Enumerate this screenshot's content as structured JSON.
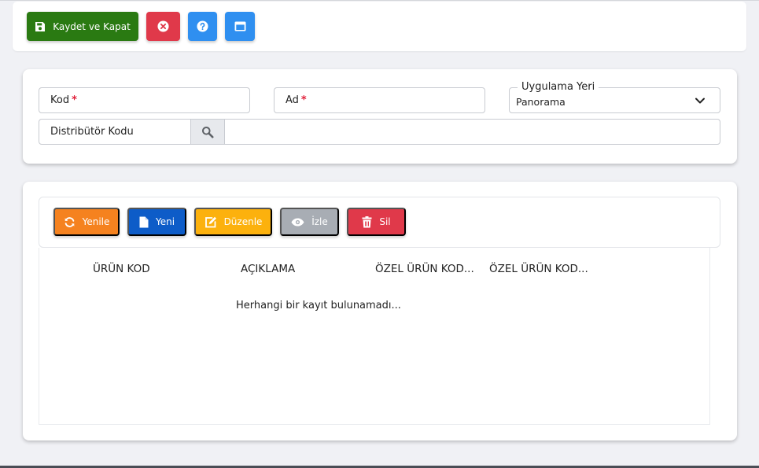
{
  "toolbar": {
    "save_label": "Kaydet ve Kapat",
    "colors": {
      "save": "#2a7a12",
      "close": "#e0394a",
      "help": "#2f8ff0",
      "window": "#2f8ff0"
    },
    "icons": [
      "save-icon",
      "close-circle-icon",
      "help-circle-icon",
      "window-icon"
    ]
  },
  "form": {
    "kod_label": "Kod",
    "ad_label": "Ad",
    "required_mark": "*",
    "uygulama_legend": "Uygulama Yeri",
    "uygulama_value": "Panorama",
    "distributor_label": "Distribütör Kodu",
    "distributor_value": ""
  },
  "list": {
    "buttons": {
      "refresh": "Yenile",
      "new": "Yeni",
      "edit": "Düzenle",
      "view": "İzle",
      "delete": "Sil"
    },
    "colors": {
      "refresh": "#f5821f",
      "new": "#0d5cc8",
      "edit": "#fcb10d",
      "view": "#a8adb4",
      "delete": "#e0394a"
    },
    "columns": [
      "ÜRÜN KOD",
      "AÇIKLAMA",
      "ÖZEL ÜRÜN KOD...",
      "ÖZEL ÜRÜN KOD..."
    ],
    "empty_message": "Herhangi bir kayıt bulunamadı..."
  }
}
